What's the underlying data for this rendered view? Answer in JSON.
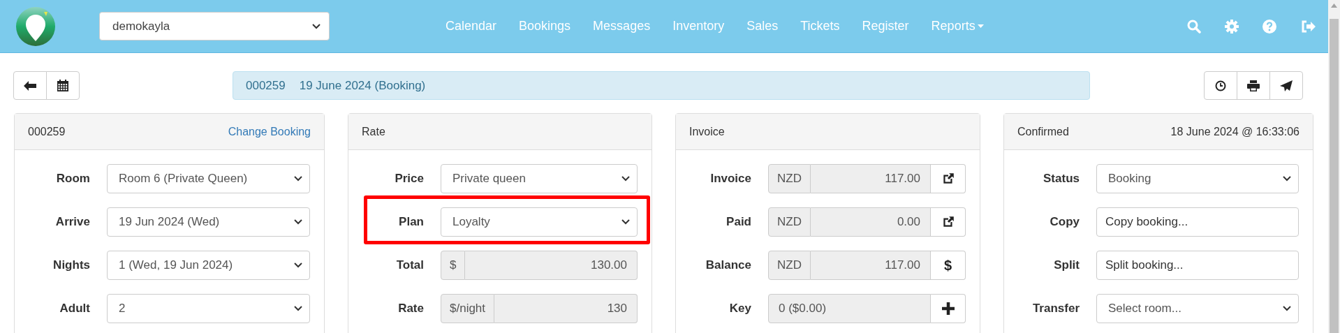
{
  "header": {
    "account": "demokayla",
    "nav": [
      {
        "label": "Calendar",
        "dropdown": false
      },
      {
        "label": "Bookings",
        "dropdown": false
      },
      {
        "label": "Messages",
        "dropdown": false
      },
      {
        "label": "Inventory",
        "dropdown": false
      },
      {
        "label": "Sales",
        "dropdown": false
      },
      {
        "label": "Tickets",
        "dropdown": false
      },
      {
        "label": "Register",
        "dropdown": false
      },
      {
        "label": "Reports",
        "dropdown": true
      }
    ]
  },
  "banner": {
    "number": "000259",
    "date": "19 June 2024",
    "type": "(Booking)"
  },
  "panels": [
    {
      "title": "000259",
      "aside": {
        "kind": "link",
        "text": "Change Booking"
      },
      "fields": [
        {
          "label": "Room",
          "kind": "select",
          "value": "Room 6 (Private Queen)",
          "highlighted": false
        },
        {
          "label": "Arrive",
          "kind": "select",
          "value": "19 Jun 2024 (Wed)",
          "highlighted": false
        },
        {
          "label": "Nights",
          "kind": "select",
          "value": "1  (Wed, 19 Jun 2024)",
          "highlighted": false
        },
        {
          "label": "Adult",
          "kind": "select",
          "value": "2",
          "highlighted": false
        }
      ]
    },
    {
      "title": "Rate",
      "fields": [
        {
          "label": "Price",
          "kind": "select",
          "value": "Private queen",
          "highlighted": false
        },
        {
          "label": "Plan",
          "kind": "select",
          "value": "Loyalty",
          "highlighted": true
        },
        {
          "label": "Total",
          "kind": "addon",
          "prefix": "$",
          "value": "130.00",
          "highlighted": false
        },
        {
          "label": "Rate",
          "kind": "addon",
          "prefix": "$/night",
          "value": "130",
          "highlighted": false
        }
      ]
    },
    {
      "title": "Invoice",
      "fields": [
        {
          "label": "Invoice",
          "kind": "addon",
          "prefix": "NZD",
          "value": "117.00",
          "button": {
            "kind": "open"
          },
          "highlighted": false
        },
        {
          "label": "Paid",
          "kind": "addon",
          "prefix": "NZD",
          "value": "0.00",
          "button": {
            "kind": "open"
          },
          "highlighted": false
        },
        {
          "label": "Balance",
          "kind": "addon",
          "prefix": "NZD",
          "value": "117.00",
          "button": {
            "kind": "text",
            "text": "$"
          },
          "highlighted": false
        },
        {
          "label": "Key",
          "kind": "readonly",
          "value": "0 ($0.00)",
          "button": {
            "kind": "add"
          },
          "highlighted": false
        }
      ]
    },
    {
      "title": "Confirmed",
      "aside": {
        "kind": "text",
        "text": "18 June 2024 @ 16:33:06"
      },
      "fields": [
        {
          "label": "Status",
          "kind": "select",
          "value": "Booking",
          "highlighted": false
        },
        {
          "label": "Copy",
          "kind": "text",
          "value": "Copy booking...",
          "highlighted": false
        },
        {
          "label": "Split",
          "kind": "text",
          "value": "Split booking...",
          "highlighted": false
        },
        {
          "label": "Transfer",
          "kind": "select",
          "value": "Select room...",
          "highlighted": false
        }
      ]
    }
  ]
}
